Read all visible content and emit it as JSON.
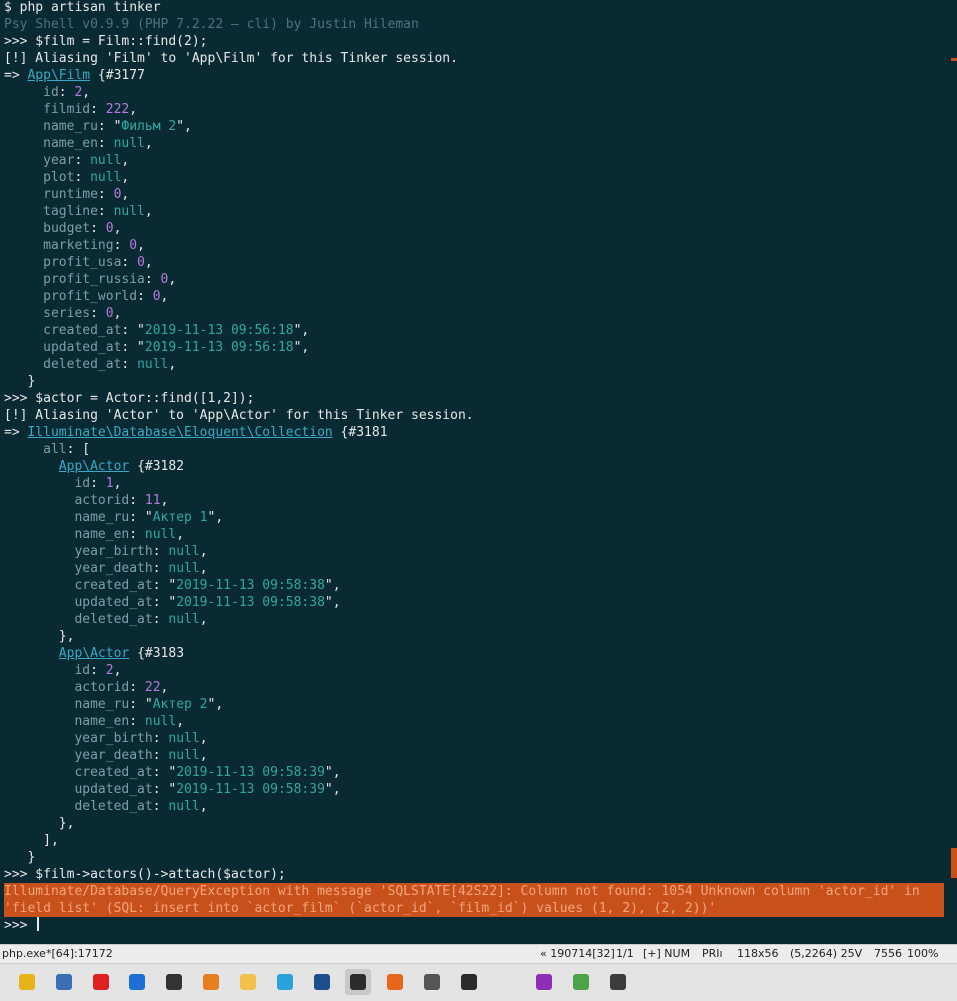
{
  "terminal": {
    "lines": [
      {
        "segs": [
          {
            "t": "$ php artisan tinker",
            "c": "w"
          }
        ]
      },
      {
        "segs": [
          {
            "t": "Psy Shell v0.9.9 (PHP 7.2.22 — cli) by Justin Hileman",
            "c": "dim"
          }
        ]
      },
      {
        "segs": [
          {
            "t": ">>> $film = Film::find(2);",
            "c": "w"
          }
        ]
      },
      {
        "segs": [
          {
            "t": "[!] Aliasing 'Film' to 'App\\Film' for this Tinker session.",
            "c": "w"
          }
        ]
      },
      {
        "segs": [
          {
            "t": "=> ",
            "c": "w"
          },
          {
            "t": "App\\Film",
            "c": "link"
          },
          {
            "t": " {#3177",
            "c": "w"
          }
        ]
      },
      {
        "segs": [
          {
            "t": "     id",
            "c": "k"
          },
          {
            "t": ": ",
            "c": "w"
          },
          {
            "t": "2",
            "c": "n"
          },
          {
            "t": ",",
            "c": "w"
          }
        ]
      },
      {
        "segs": [
          {
            "t": "     filmid",
            "c": "k"
          },
          {
            "t": ": ",
            "c": "w"
          },
          {
            "t": "222",
            "c": "n"
          },
          {
            "t": ",",
            "c": "w"
          }
        ]
      },
      {
        "segs": [
          {
            "t": "     name_ru",
            "c": "k"
          },
          {
            "t": ": \"",
            "c": "w"
          },
          {
            "t": "Фильм 2",
            "c": "s"
          },
          {
            "t": "\",",
            "c": "w"
          }
        ]
      },
      {
        "segs": [
          {
            "t": "     name_en",
            "c": "k"
          },
          {
            "t": ": ",
            "c": "w"
          },
          {
            "t": "null",
            "c": "u"
          },
          {
            "t": ",",
            "c": "w"
          }
        ]
      },
      {
        "segs": [
          {
            "t": "     year",
            "c": "k"
          },
          {
            "t": ": ",
            "c": "w"
          },
          {
            "t": "null",
            "c": "u"
          },
          {
            "t": ",",
            "c": "w"
          }
        ]
      },
      {
        "segs": [
          {
            "t": "     plot",
            "c": "k"
          },
          {
            "t": ": ",
            "c": "w"
          },
          {
            "t": "null",
            "c": "u"
          },
          {
            "t": ",",
            "c": "w"
          }
        ]
      },
      {
        "segs": [
          {
            "t": "     runtime",
            "c": "k"
          },
          {
            "t": ": ",
            "c": "w"
          },
          {
            "t": "0",
            "c": "n"
          },
          {
            "t": ",",
            "c": "w"
          }
        ]
      },
      {
        "segs": [
          {
            "t": "     tagline",
            "c": "k"
          },
          {
            "t": ": ",
            "c": "w"
          },
          {
            "t": "null",
            "c": "u"
          },
          {
            "t": ",",
            "c": "w"
          }
        ]
      },
      {
        "segs": [
          {
            "t": "     budget",
            "c": "k"
          },
          {
            "t": ": ",
            "c": "w"
          },
          {
            "t": "0",
            "c": "n"
          },
          {
            "t": ",",
            "c": "w"
          }
        ]
      },
      {
        "segs": [
          {
            "t": "     marketing",
            "c": "k"
          },
          {
            "t": ": ",
            "c": "w"
          },
          {
            "t": "0",
            "c": "n"
          },
          {
            "t": ",",
            "c": "w"
          }
        ]
      },
      {
        "segs": [
          {
            "t": "     profit_usa",
            "c": "k"
          },
          {
            "t": ": ",
            "c": "w"
          },
          {
            "t": "0",
            "c": "n"
          },
          {
            "t": ",",
            "c": "w"
          }
        ]
      },
      {
        "segs": [
          {
            "t": "     profit_russia",
            "c": "k"
          },
          {
            "t": ": ",
            "c": "w"
          },
          {
            "t": "0",
            "c": "n"
          },
          {
            "t": ",",
            "c": "w"
          }
        ]
      },
      {
        "segs": [
          {
            "t": "     profit_world",
            "c": "k"
          },
          {
            "t": ": ",
            "c": "w"
          },
          {
            "t": "0",
            "c": "n"
          },
          {
            "t": ",",
            "c": "w"
          }
        ]
      },
      {
        "segs": [
          {
            "t": "     series",
            "c": "k"
          },
          {
            "t": ": ",
            "c": "w"
          },
          {
            "t": "0",
            "c": "n"
          },
          {
            "t": ",",
            "c": "w"
          }
        ]
      },
      {
        "segs": [
          {
            "t": "     created_at",
            "c": "k"
          },
          {
            "t": ": \"",
            "c": "w"
          },
          {
            "t": "2019-11-13 09:56:18",
            "c": "s"
          },
          {
            "t": "\",",
            "c": "w"
          }
        ]
      },
      {
        "segs": [
          {
            "t": "     updated_at",
            "c": "k"
          },
          {
            "t": ": \"",
            "c": "w"
          },
          {
            "t": "2019-11-13 09:56:18",
            "c": "s"
          },
          {
            "t": "\",",
            "c": "w"
          }
        ]
      },
      {
        "segs": [
          {
            "t": "     deleted_at",
            "c": "k"
          },
          {
            "t": ": ",
            "c": "w"
          },
          {
            "t": "null",
            "c": "u"
          },
          {
            "t": ",",
            "c": "w"
          }
        ]
      },
      {
        "segs": [
          {
            "t": "   }",
            "c": "w"
          }
        ]
      },
      {
        "segs": [
          {
            "t": ">>> $actor = Actor::find([1,2]);",
            "c": "w"
          }
        ]
      },
      {
        "segs": [
          {
            "t": "[!] Aliasing 'Actor' to 'App\\Actor' for this Tinker session.",
            "c": "w"
          }
        ]
      },
      {
        "segs": [
          {
            "t": "=> ",
            "c": "w"
          },
          {
            "t": "Illuminate\\Database\\Eloquent\\Collection",
            "c": "link"
          },
          {
            "t": " {#3181",
            "c": "w"
          }
        ]
      },
      {
        "segs": [
          {
            "t": "     all",
            "c": "k"
          },
          {
            "t": ": [",
            "c": "w"
          }
        ]
      },
      {
        "segs": [
          {
            "t": "       ",
            "c": "w"
          },
          {
            "t": "App\\Actor",
            "c": "link"
          },
          {
            "t": " {#3182",
            "c": "w"
          }
        ]
      },
      {
        "segs": [
          {
            "t": "         id",
            "c": "k"
          },
          {
            "t": ": ",
            "c": "w"
          },
          {
            "t": "1",
            "c": "n"
          },
          {
            "t": ",",
            "c": "w"
          }
        ]
      },
      {
        "segs": [
          {
            "t": "         actorid",
            "c": "k"
          },
          {
            "t": ": ",
            "c": "w"
          },
          {
            "t": "11",
            "c": "n"
          },
          {
            "t": ",",
            "c": "w"
          }
        ]
      },
      {
        "segs": [
          {
            "t": "         name_ru",
            "c": "k"
          },
          {
            "t": ": \"",
            "c": "w"
          },
          {
            "t": "Актер 1",
            "c": "s"
          },
          {
            "t": "\",",
            "c": "w"
          }
        ]
      },
      {
        "segs": [
          {
            "t": "         name_en",
            "c": "k"
          },
          {
            "t": ": ",
            "c": "w"
          },
          {
            "t": "null",
            "c": "u"
          },
          {
            "t": ",",
            "c": "w"
          }
        ]
      },
      {
        "segs": [
          {
            "t": "         year_birth",
            "c": "k"
          },
          {
            "t": ": ",
            "c": "w"
          },
          {
            "t": "null",
            "c": "u"
          },
          {
            "t": ",",
            "c": "w"
          }
        ]
      },
      {
        "segs": [
          {
            "t": "         year_death",
            "c": "k"
          },
          {
            "t": ": ",
            "c": "w"
          },
          {
            "t": "null",
            "c": "u"
          },
          {
            "t": ",",
            "c": "w"
          }
        ]
      },
      {
        "segs": [
          {
            "t": "         created_at",
            "c": "k"
          },
          {
            "t": ": \"",
            "c": "w"
          },
          {
            "t": "2019-11-13 09:58:38",
            "c": "s"
          },
          {
            "t": "\",",
            "c": "w"
          }
        ]
      },
      {
        "segs": [
          {
            "t": "         updated_at",
            "c": "k"
          },
          {
            "t": ": \"",
            "c": "w"
          },
          {
            "t": "2019-11-13 09:58:38",
            "c": "s"
          },
          {
            "t": "\",",
            "c": "w"
          }
        ]
      },
      {
        "segs": [
          {
            "t": "         deleted_at",
            "c": "k"
          },
          {
            "t": ": ",
            "c": "w"
          },
          {
            "t": "null",
            "c": "u"
          },
          {
            "t": ",",
            "c": "w"
          }
        ]
      },
      {
        "segs": [
          {
            "t": "       },",
            "c": "w"
          }
        ]
      },
      {
        "segs": [
          {
            "t": "       ",
            "c": "w"
          },
          {
            "t": "App\\Actor",
            "c": "link"
          },
          {
            "t": " {#3183",
            "c": "w"
          }
        ]
      },
      {
        "segs": [
          {
            "t": "         id",
            "c": "k"
          },
          {
            "t": ": ",
            "c": "w"
          },
          {
            "t": "2",
            "c": "n"
          },
          {
            "t": ",",
            "c": "w"
          }
        ]
      },
      {
        "segs": [
          {
            "t": "         actorid",
            "c": "k"
          },
          {
            "t": ": ",
            "c": "w"
          },
          {
            "t": "22",
            "c": "n"
          },
          {
            "t": ",",
            "c": "w"
          }
        ]
      },
      {
        "segs": [
          {
            "t": "         name_ru",
            "c": "k"
          },
          {
            "t": ": \"",
            "c": "w"
          },
          {
            "t": "Актер 2",
            "c": "s"
          },
          {
            "t": "\",",
            "c": "w"
          }
        ]
      },
      {
        "segs": [
          {
            "t": "         name_en",
            "c": "k"
          },
          {
            "t": ": ",
            "c": "w"
          },
          {
            "t": "null",
            "c": "u"
          },
          {
            "t": ",",
            "c": "w"
          }
        ]
      },
      {
        "segs": [
          {
            "t": "         year_birth",
            "c": "k"
          },
          {
            "t": ": ",
            "c": "w"
          },
          {
            "t": "null",
            "c": "u"
          },
          {
            "t": ",",
            "c": "w"
          }
        ]
      },
      {
        "segs": [
          {
            "t": "         year_death",
            "c": "k"
          },
          {
            "t": ": ",
            "c": "w"
          },
          {
            "t": "null",
            "c": "u"
          },
          {
            "t": ",",
            "c": "w"
          }
        ]
      },
      {
        "segs": [
          {
            "t": "         created_at",
            "c": "k"
          },
          {
            "t": ": \"",
            "c": "w"
          },
          {
            "t": "2019-11-13 09:58:39",
            "c": "s"
          },
          {
            "t": "\",",
            "c": "w"
          }
        ]
      },
      {
        "segs": [
          {
            "t": "         updated_at",
            "c": "k"
          },
          {
            "t": ": \"",
            "c": "w"
          },
          {
            "t": "2019-11-13 09:58:39",
            "c": "s"
          },
          {
            "t": "\",",
            "c": "w"
          }
        ]
      },
      {
        "segs": [
          {
            "t": "         deleted_at",
            "c": "k"
          },
          {
            "t": ": ",
            "c": "w"
          },
          {
            "t": "null",
            "c": "u"
          },
          {
            "t": ",",
            "c": "w"
          }
        ]
      },
      {
        "segs": [
          {
            "t": "       },",
            "c": "w"
          }
        ]
      },
      {
        "segs": [
          {
            "t": "     ],",
            "c": "w"
          }
        ]
      },
      {
        "segs": [
          {
            "t": "   }",
            "c": "w"
          }
        ]
      },
      {
        "segs": [
          {
            "t": ">>> $film->actors()->attach($actor);",
            "c": "w"
          }
        ]
      }
    ],
    "error_lines": [
      "Illuminate/Database/QueryException with message 'SQLSTATE[42S22]: Column not found: 1054 Unknown column 'actor_id' in",
      "'field list' (SQL: insert into `actor_film` (`actor_id`, `film_id`) values (1, 2), (2, 2))'"
    ],
    "prompt": ">>> "
  },
  "statusbar": {
    "process": "php.exe*[64]:17172",
    "build": "« 190714[32]",
    "tab": "1/1",
    "mode": "[+] NUM",
    "priority": "PRIı",
    "size": "118x56",
    "cursor": "(5,2264) 25V",
    "pid": "7556",
    "zoom": "100%"
  },
  "taskbar": {
    "icons": [
      {
        "name": "chrome-icon",
        "color": "#e8b21a"
      },
      {
        "name": "network-icon",
        "color": "#3a6fb5"
      },
      {
        "name": "yandex-browser-icon",
        "color": "#e02020"
      },
      {
        "name": "teamviewer-icon",
        "color": "#1d6fd6"
      },
      {
        "name": "terminal-icon",
        "color": "#333333"
      },
      {
        "name": "sublime-text-icon",
        "color": "#e67e22"
      },
      {
        "name": "file-explorer-icon",
        "color": "#f2c14a"
      },
      {
        "name": "telegram-icon",
        "color": "#2aa3dc"
      },
      {
        "name": "vpn-icon",
        "color": "#1e4d8c"
      },
      {
        "name": "conemu-icon",
        "color": "#2b2b2b"
      },
      {
        "name": "firefox-icon",
        "color": "#e8661c"
      },
      {
        "name": "calculator-icon",
        "color": "#555555"
      },
      {
        "name": "console-icon",
        "color": "#2b2b2b"
      },
      {
        "name": "phpstorm-icon",
        "color": "#8b2fb5"
      },
      {
        "name": "paint-icon",
        "color": "#4ea24a"
      },
      {
        "name": "image-viewer-icon",
        "color": "#3c3c3c"
      }
    ]
  }
}
